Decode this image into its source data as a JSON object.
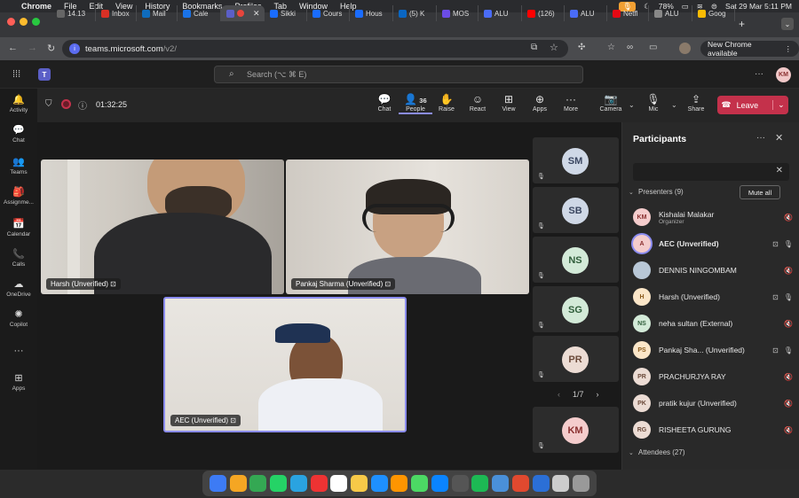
{
  "menubar": {
    "app": "Chrome",
    "items": [
      "File",
      "Edit",
      "View",
      "History",
      "Bookmarks",
      "Profiles",
      "Tab",
      "Window",
      "Help"
    ],
    "battery": "78%",
    "datetime": "Sat 29 Mar  5:11 PM"
  },
  "tabs": [
    {
      "label": "14.13",
      "color": "#666"
    },
    {
      "label": "Inbox",
      "color": "#d93025"
    },
    {
      "label": "Mail",
      "color": "#0f6cbd"
    },
    {
      "label": "Cale",
      "color": "#1a73e8"
    },
    {
      "label": "",
      "color": "#5b5fc7",
      "active": true
    },
    {
      "label": "Sikki",
      "color": "#1a6cff"
    },
    {
      "label": "Cours",
      "color": "#1a6cff"
    },
    {
      "label": "Hous",
      "color": "#1a6cff"
    },
    {
      "label": "(5) K",
      "color": "#0a66c2"
    },
    {
      "label": "MOS",
      "color": "#6b4ce6"
    },
    {
      "label": "ALU",
      "color": "#4a6cf7"
    },
    {
      "label": "(126)",
      "color": "#ff0000"
    },
    {
      "label": "ALU",
      "color": "#4a6cf7"
    },
    {
      "label": "Netfl",
      "color": "#e50914"
    },
    {
      "label": "ALU",
      "color": "#888"
    },
    {
      "label": "Goog",
      "color": "#fbbc04"
    }
  ],
  "address": {
    "host": "teams.microsoft.com",
    "path": "/v2/"
  },
  "new_chrome": "New Chrome available",
  "search": {
    "placeholder": "Search (⌥ ⌘ E)"
  },
  "me_initials": "KM",
  "rail": [
    {
      "label": "Activity",
      "icon": "🔔"
    },
    {
      "label": "Chat",
      "icon": "💬"
    },
    {
      "label": "Teams",
      "icon": "👥"
    },
    {
      "label": "Assignme...",
      "icon": "🎒"
    },
    {
      "label": "Calendar",
      "icon": "📅"
    },
    {
      "label": "Calls",
      "icon": "📞"
    },
    {
      "label": "OneDrive",
      "icon": "☁"
    },
    {
      "label": "Copilot",
      "icon": "✺"
    },
    {
      "label": "",
      "icon": "···"
    },
    {
      "label": "Apps",
      "icon": "⊞"
    }
  ],
  "meeting": {
    "timer": "01:32:25",
    "toolbar": [
      {
        "label": "Chat",
        "icon": "💬"
      },
      {
        "label": "People",
        "icon": "👤",
        "badge": "36"
      },
      {
        "label": "Raise",
        "icon": "✋"
      },
      {
        "label": "React",
        "icon": "☺"
      },
      {
        "label": "View",
        "icon": "⊞"
      },
      {
        "label": "Apps",
        "icon": "⊕"
      },
      {
        "label": "More",
        "icon": "···"
      },
      {
        "label": "Camera",
        "icon": "📷"
      },
      {
        "label": "Mic",
        "icon": "🎙"
      },
      {
        "label": "Share",
        "icon": "⇪"
      }
    ],
    "leave": "Leave"
  },
  "videos": [
    {
      "name": "Harsh (Unverified)"
    },
    {
      "name": "Pankaj Sharma (Unverified)"
    },
    {
      "name": "AEC (Unverified)"
    }
  ],
  "side_tiles": [
    {
      "initials": "SM",
      "bg": "#cfd8e6",
      "fg": "#3a4660"
    },
    {
      "initials": "SB",
      "bg": "#cfd8e6",
      "fg": "#3a4660"
    },
    {
      "initials": "NS",
      "bg": "#d3ead8",
      "fg": "#2f5d3a"
    },
    {
      "initials": "SG",
      "bg": "#d3ead8",
      "fg": "#2f5d3a"
    },
    {
      "initials": "PR",
      "bg": "#ecdcd4",
      "fg": "#6b4a3a"
    },
    {
      "initials": "KM",
      "bg": "#f4cccc",
      "fg": "#8a2f2f"
    }
  ],
  "pager": "1/7",
  "panel": {
    "title": "Participants",
    "presenters_label": "Presenters (9)",
    "mute_all": "Mute all",
    "attendees_label": "Attendees (27)",
    "people": [
      {
        "initials": "KM",
        "name": "Kishalai Malakar",
        "sub": "Organizer",
        "bg": "#f4cccc",
        "fg": "#8a2f2f",
        "muted": true
      },
      {
        "initials": "A",
        "name": "AEC (Unverified)",
        "sub": "",
        "bg": "#f4cccc",
        "fg": "#8a2f2f",
        "muted": false,
        "bold": true
      },
      {
        "initials": "",
        "name": "DENNIS NINGOMBAM",
        "sub": "",
        "bg": "#b8c7d6",
        "fg": "#333",
        "muted": true
      },
      {
        "initials": "H",
        "name": "Harsh (Unverified)",
        "sub": "",
        "bg": "#fbe6c8",
        "fg": "#8a5a1a",
        "muted": false
      },
      {
        "initials": "NS",
        "name": "neha sultan (External)",
        "sub": "",
        "bg": "#d3ead8",
        "fg": "#2f5d3a",
        "muted": true
      },
      {
        "initials": "PS",
        "name": "Pankaj Sha... (Unverified)",
        "sub": "",
        "bg": "#fbe6c8",
        "fg": "#8a5a1a",
        "muted": false
      },
      {
        "initials": "PR",
        "name": "PRACHURJYA RAY",
        "sub": "",
        "bg": "#ecdcd4",
        "fg": "#6b4a3a",
        "muted": true
      },
      {
        "initials": "PK",
        "name": "pratik kujur (Unverified)",
        "sub": "",
        "bg": "#ecdcd4",
        "fg": "#6b4a3a",
        "muted": true
      },
      {
        "initials": "RG",
        "name": "RISHEETA GURUNG",
        "sub": "",
        "bg": "#ecdcd4",
        "fg": "#6b4a3a",
        "muted": true
      }
    ]
  },
  "dock_colors": [
    "#3d7bf5",
    "#f5a623",
    "#34a853",
    "#25d366",
    "#2aa3e0",
    "#e33",
    "#fff",
    "#f7c948",
    "#1e90ff",
    "#ff9500",
    "#4cd964",
    "#0a84ff",
    "#555",
    "#1db954",
    "#4a90d9",
    "#e0492f",
    "#2b6fd6",
    "#ccc",
    "#999"
  ]
}
